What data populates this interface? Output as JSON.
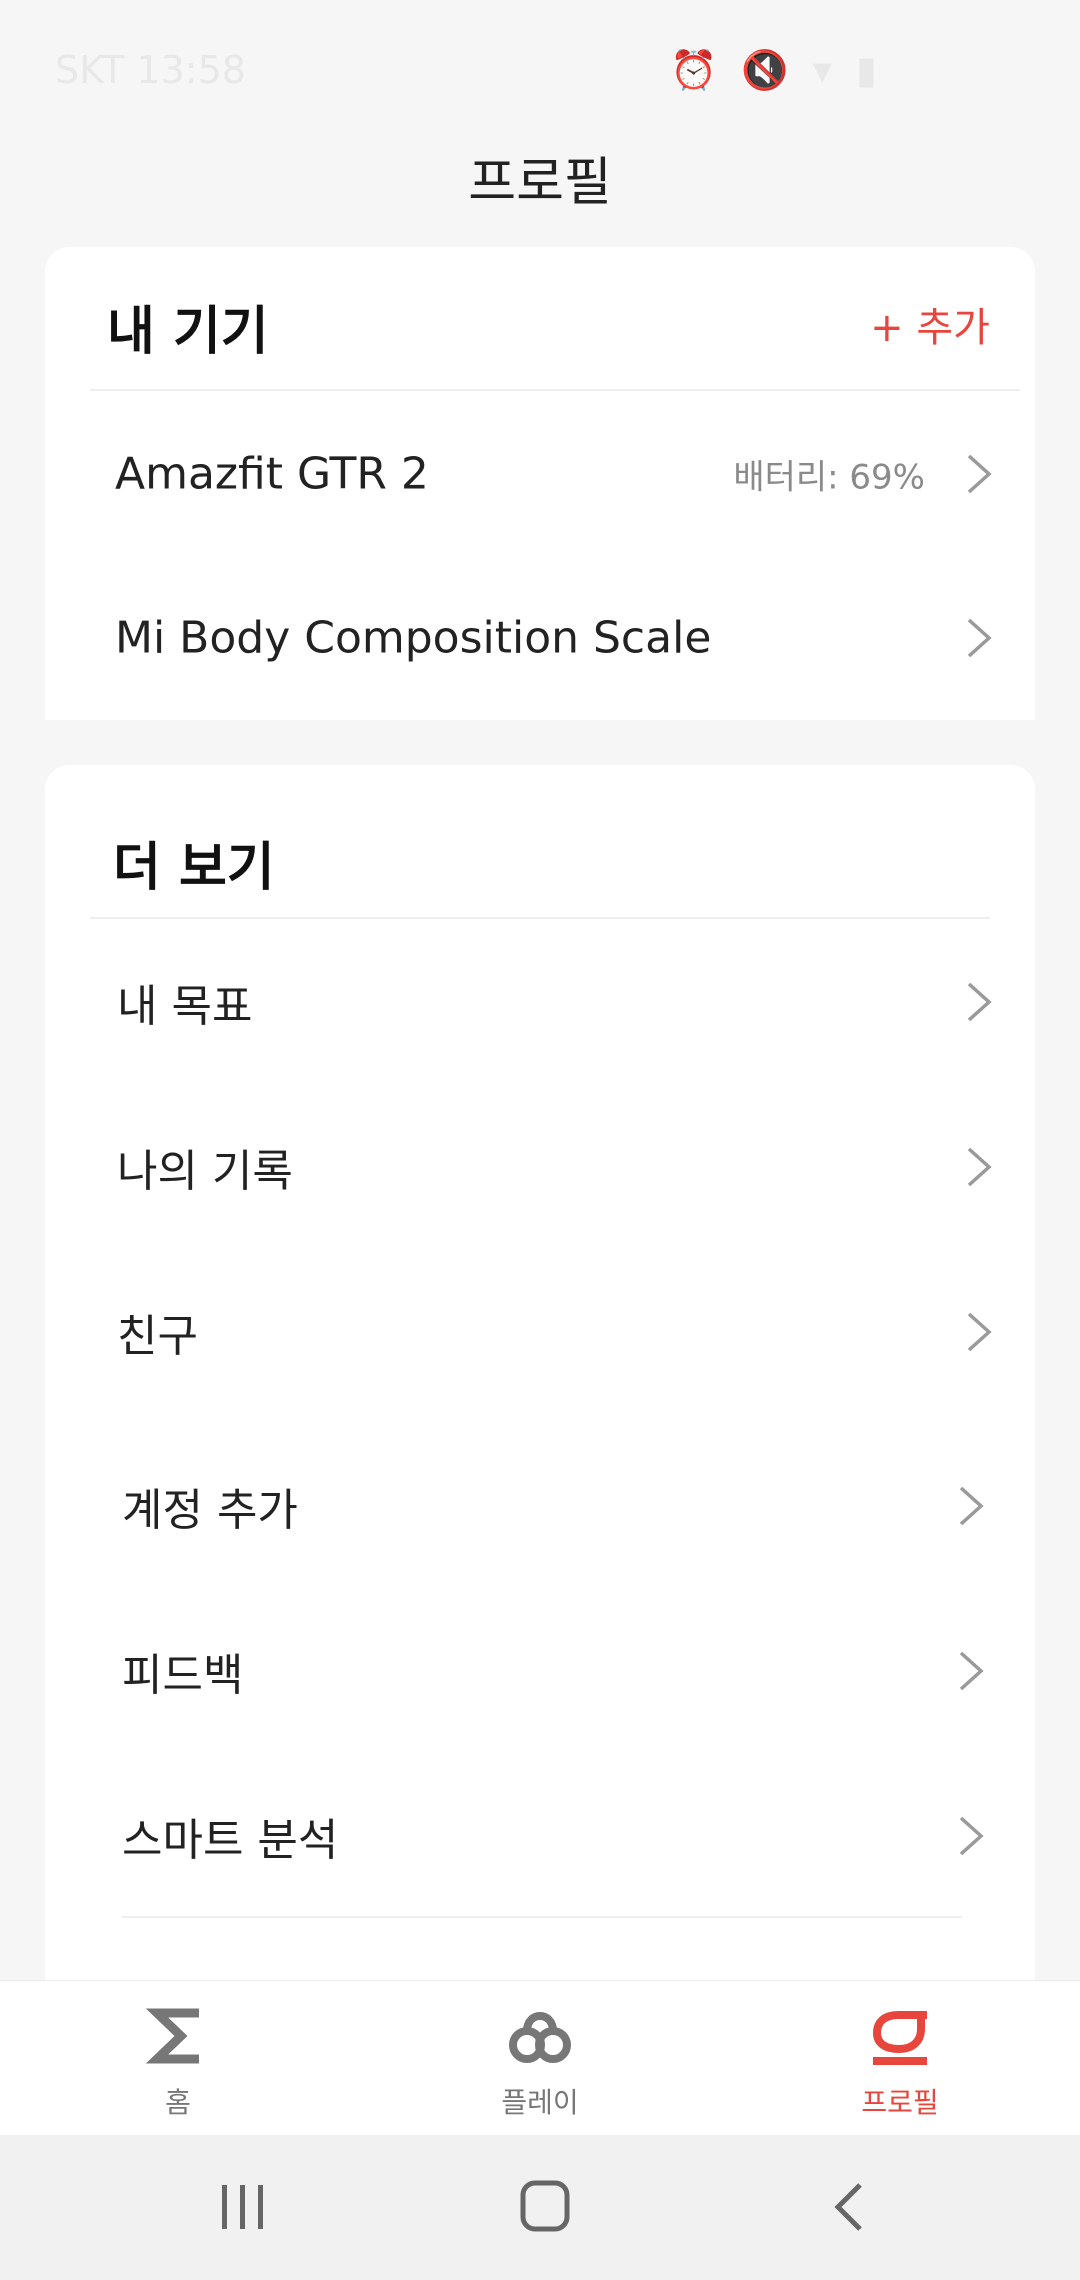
{
  "status_bar": {
    "carrier": "SKT",
    "time": "13:58"
  },
  "header": {
    "title": "프로필"
  },
  "devices_section": {
    "title": "내 기기",
    "add_label": "+ 추가",
    "items": [
      {
        "label": "Amazfit GTR 2",
        "value": "배터리: 69%"
      },
      {
        "label": "Mi Body Composition Scale"
      }
    ]
  },
  "more_section": {
    "title": "더 보기",
    "items": [
      {
        "label": "내 목표"
      },
      {
        "label": "나의 기록"
      },
      {
        "label": "친구"
      },
      {
        "label": "계정 추가"
      },
      {
        "label": "피드백"
      },
      {
        "label": "스마트 분석"
      }
    ]
  },
  "bottom_nav": {
    "items": [
      {
        "label": "홈",
        "icon": "sigma-icon",
        "active": false
      },
      {
        "label": "플레이",
        "icon": "play-loop-icon",
        "active": false
      },
      {
        "label": "프로필",
        "icon": "profile-icon",
        "active": true
      }
    ]
  },
  "colors": {
    "accent": "#e8453c",
    "chevron": "#9a9a9a"
  }
}
